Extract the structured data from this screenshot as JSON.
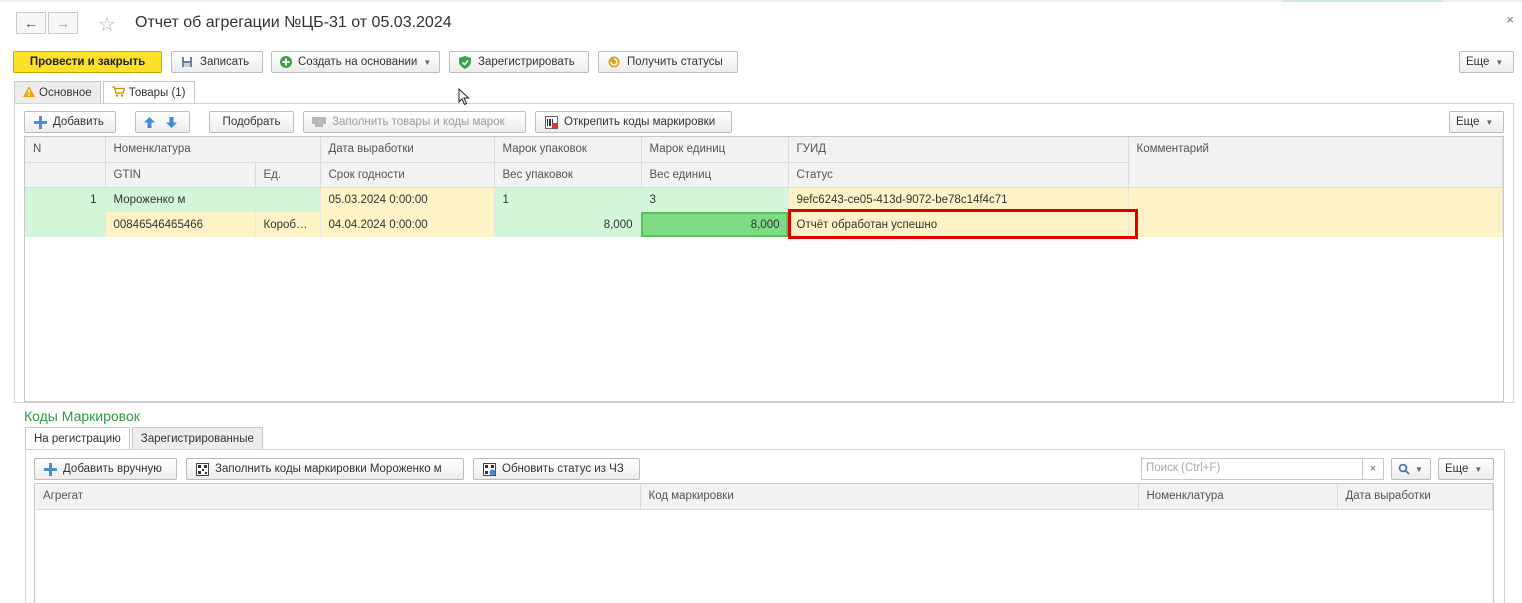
{
  "window": {
    "title": "Отчет об агрегации №ЦБ-31 от 05.03.2024",
    "back_icon": "←",
    "forward_icon": "→",
    "favorite_icon": "☆",
    "close_icon": "×"
  },
  "toolbar": {
    "post_close": "Провести и закрыть",
    "save": "Записать",
    "create_based": "Создать на основании",
    "register": "Зарегистрировать",
    "get_statuses": "Получить статусы",
    "more": "Еще"
  },
  "tabs": [
    {
      "label": "Основное",
      "icon": "warning-icon"
    },
    {
      "label": "Товары (1)",
      "icon": "cart-icon"
    }
  ],
  "goods_toolbar": {
    "add": "Добавить",
    "pick": "Подобрать",
    "fill": "Заполнить товары и коды марок",
    "unpin": "Открепить коды маркировки",
    "more": "Еще"
  },
  "goods_table": {
    "headers_row1": [
      "N",
      "Номенклатура",
      "Дата выработки",
      "Марок упаковок",
      "Марок единиц",
      "ГУИД",
      "Комментарий"
    ],
    "headers_row2": [
      "GTIN",
      "Ед.",
      "Срок годности",
      "Вес упаковок",
      "Вес единиц",
      "Статус"
    ],
    "row1": {
      "n": "1",
      "nomenclature": "Мороженко м",
      "production_date": "05.03.2024 0:00:00",
      "pack_marks": "1",
      "unit_marks": "3",
      "guid": "9efc6243-ce05-413d-9072-be78c14f4c71",
      "comment": ""
    },
    "row2": {
      "gtin": "00846546465466",
      "unit": "Короб…",
      "expiry": "04.04.2024 0:00:00",
      "pack_weight": "8,000",
      "unit_weight": "8,000",
      "status": "Отчёт обработан успешно"
    }
  },
  "marking": {
    "section_title": "Коды Маркировок",
    "tabs": [
      "На регистрацию",
      "Зарегистрированные"
    ],
    "add_manual": "Добавить вручную",
    "fill_codes": "Заполнить коды маркировки Мороженко м",
    "update_status": "Обновить статус из ЧЗ",
    "search_placeholder": "Поиск (Ctrl+F)",
    "more": "Еще",
    "headers": [
      "Агрегат",
      "Код маркировки",
      "Номенклатура",
      "Дата выработки"
    ]
  }
}
